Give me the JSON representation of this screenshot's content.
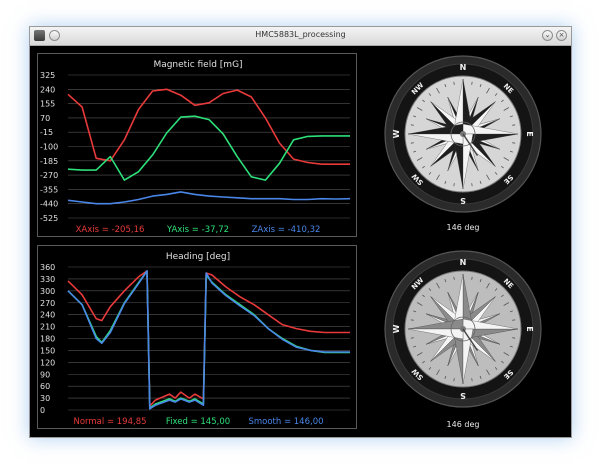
{
  "window": {
    "title": "HMC5883L_processing",
    "minimize_glyph": "⌄",
    "close_glyph": "×"
  },
  "icons": {
    "menu": "window-menu-icon",
    "pin": "pin-icon",
    "minimize": "chevron-down-icon",
    "close": "close-icon"
  },
  "colors": {
    "red": "#e83a3a",
    "green": "#2ee07a",
    "blue": "#4a86e8",
    "grid": "#555555",
    "text": "#e0e0e0"
  },
  "chart_data": [
    {
      "type": "line",
      "title": "Magnetic field [mG]",
      "ylim": [
        -525,
        325
      ],
      "yticks": [
        325,
        240,
        155,
        70,
        -15,
        -100,
        -185,
        -270,
        -355,
        -440,
        -525
      ],
      "x": [
        0,
        5,
        10,
        15,
        20,
        25,
        30,
        35,
        40,
        45,
        50,
        55,
        60,
        65,
        70,
        75,
        80,
        85,
        90,
        95,
        100
      ],
      "series": [
        {
          "name": "XAxis",
          "color": "#e83a3a",
          "readout": "XAxis = -205,16",
          "values": [
            210,
            135,
            -170,
            -185,
            -60,
            120,
            230,
            240,
            205,
            145,
            160,
            215,
            235,
            195,
            70,
            -80,
            -175,
            -195,
            -205,
            -205,
            -205
          ]
        },
        {
          "name": "YAxis",
          "color": "#2ee07a",
          "readout": "YAxis = -37,72",
          "values": [
            -235,
            -240,
            -240,
            -160,
            -300,
            -250,
            -150,
            -20,
            75,
            80,
            60,
            -25,
            -160,
            -280,
            -300,
            -200,
            -60,
            -40,
            -37,
            -37,
            -37
          ]
        },
        {
          "name": "ZAxis",
          "color": "#4a86e8",
          "readout": "ZAxis = -410,32",
          "values": [
            -420,
            -430,
            -440,
            -440,
            -430,
            -415,
            -395,
            -385,
            -370,
            -385,
            -395,
            -400,
            -405,
            -410,
            -410,
            -410,
            -415,
            -415,
            -410,
            -412,
            -410
          ]
        }
      ]
    },
    {
      "type": "line",
      "title": "Heading [deg]",
      "ylim": [
        0,
        360
      ],
      "yticks": [
        360,
        330,
        300,
        270,
        240,
        210,
        180,
        150,
        120,
        90,
        60,
        30,
        0
      ],
      "x": [
        0,
        5,
        10,
        12,
        15,
        20,
        25,
        28,
        29,
        31,
        36,
        38,
        40,
        43,
        45,
        48,
        49,
        51,
        56,
        61,
        66,
        71,
        76,
        81,
        86,
        91,
        96,
        100
      ],
      "series": [
        {
          "name": "Normal",
          "color": "#e83a3a",
          "readout": "Normal = 194,85",
          "values": [
            325,
            290,
            230,
            225,
            260,
            300,
            335,
            350,
            10,
            25,
            40,
            30,
            45,
            30,
            40,
            28,
            345,
            340,
            310,
            285,
            265,
            240,
            215,
            205,
            198,
            195,
            195,
            195
          ]
        },
        {
          "name": "Fixed",
          "color": "#2ee07a",
          "readout": "Fixed = 145,00",
          "values": [
            300,
            265,
            185,
            170,
            200,
            270,
            320,
            350,
            5,
            15,
            28,
            22,
            30,
            22,
            28,
            15,
            340,
            322,
            290,
            265,
            240,
            205,
            180,
            160,
            150,
            145,
            145,
            145
          ]
        },
        {
          "name": "Smooth",
          "color": "#4a86e8",
          "readout": "Smooth = 146,00",
          "values": [
            300,
            265,
            180,
            168,
            195,
            268,
            318,
            350,
            3,
            12,
            25,
            20,
            28,
            20,
            25,
            12,
            345,
            320,
            288,
            262,
            238,
            205,
            178,
            158,
            150,
            146,
            146,
            146
          ]
        }
      ]
    }
  ],
  "compasses": [
    {
      "heading_value": 146,
      "label": "146 deg",
      "style": "dark"
    },
    {
      "heading_value": 146,
      "label": "146 deg",
      "style": "light"
    }
  ],
  "compass_text": {
    "N": "N",
    "NE": "NE",
    "E": "E",
    "SE": "SE",
    "S": "S",
    "SW": "SW",
    "W": "W",
    "NW": "NW"
  }
}
